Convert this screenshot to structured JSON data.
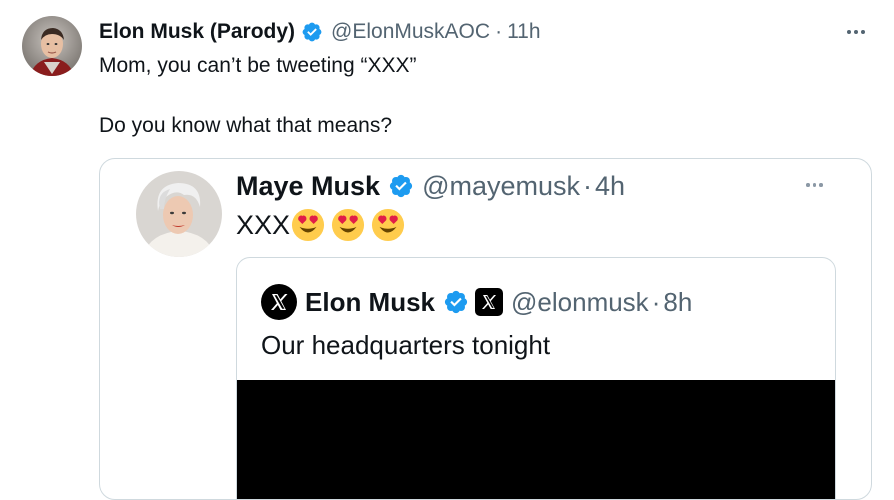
{
  "main_tweet": {
    "author_name": "Elon Musk (Parody)",
    "handle": "@ElonMuskAOC",
    "separator": "·",
    "time": "11h",
    "text_line1": "Mom, you can’t be tweeting “XXX”",
    "text_line2": "Do you know what that means?",
    "more_icon": "more-horizontal-icon"
  },
  "quoted_tweet": {
    "author_name": "Maye Musk",
    "handle": "@mayemusk",
    "separator": "·",
    "time": "4h",
    "text": "XXX",
    "emojis": [
      "heart-eyes-emoji",
      "heart-eyes-emoji",
      "heart-eyes-emoji"
    ]
  },
  "nested_quote": {
    "author_name": "Elon Musk",
    "handle": "@elonmusk",
    "separator": "·",
    "time": "8h",
    "text": "Our headquarters tonight"
  },
  "colors": {
    "verified_blue": "#1d9bf0",
    "secondary_text": "#536471",
    "border": "#cfd9de"
  }
}
